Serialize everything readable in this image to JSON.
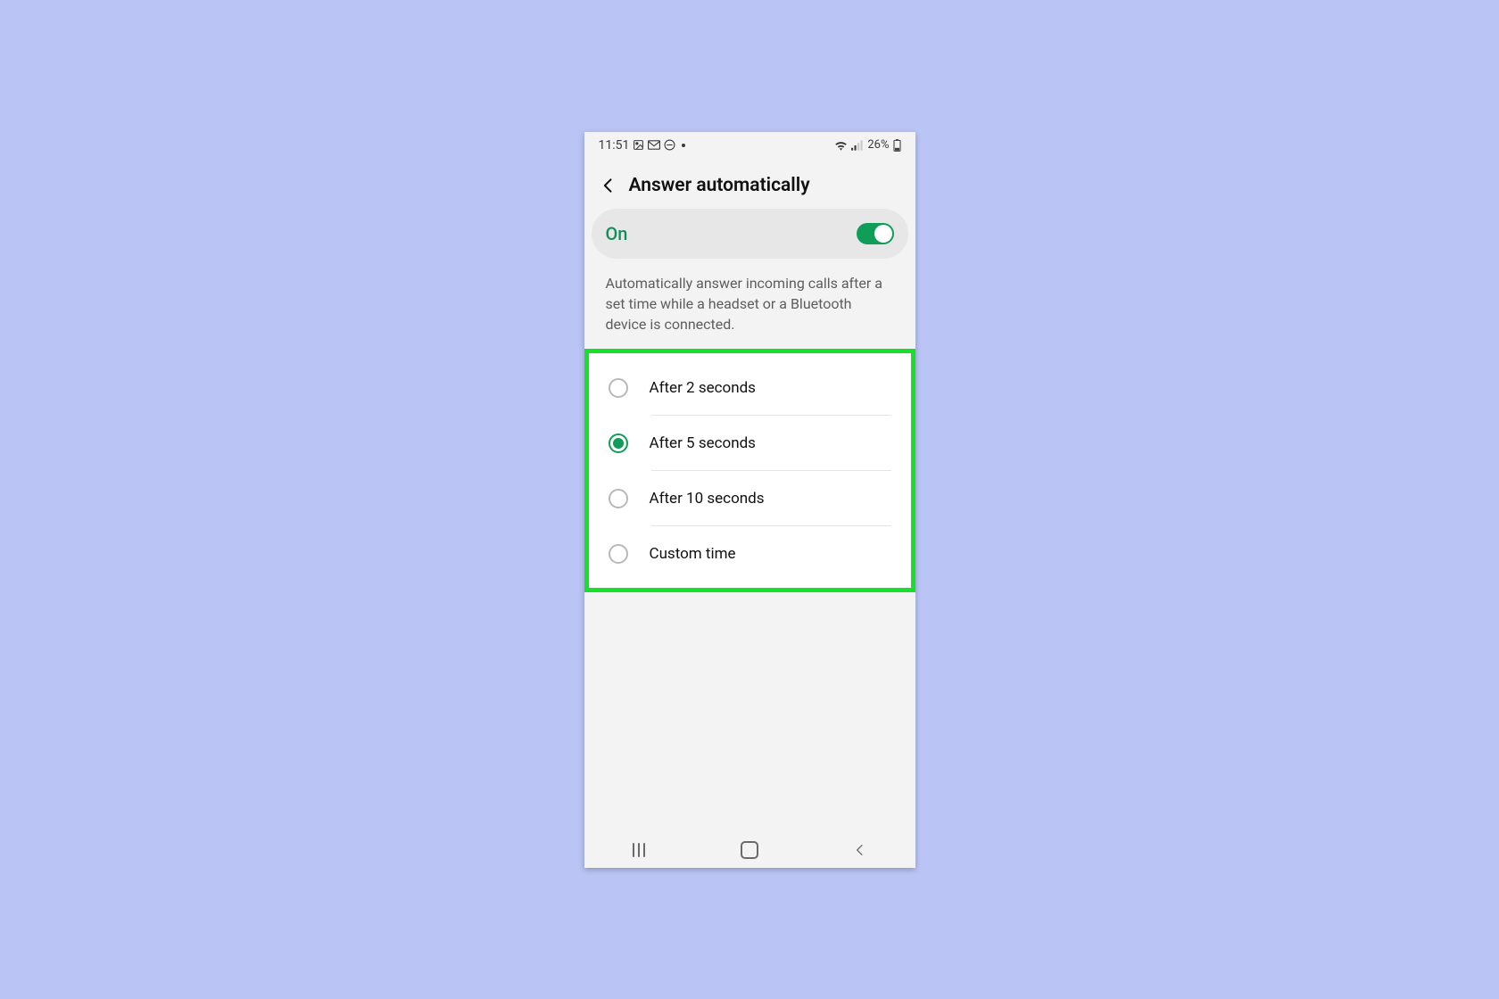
{
  "statusbar": {
    "time": "11:51",
    "battery": "26%"
  },
  "header": {
    "title": "Answer automatically"
  },
  "toggle": {
    "label": "On",
    "enabled": true
  },
  "description": "Automatically answer incoming calls after a set time while a headset or a Bluetooth device is connected.",
  "options": [
    {
      "label": "After 2 seconds",
      "selected": false
    },
    {
      "label": "After 5 seconds",
      "selected": true
    },
    {
      "label": "After 10 seconds",
      "selected": false
    },
    {
      "label": "Custom time",
      "selected": false
    }
  ],
  "colors": {
    "highlight_border": "#17e02a",
    "accent": "#0f9d58"
  }
}
